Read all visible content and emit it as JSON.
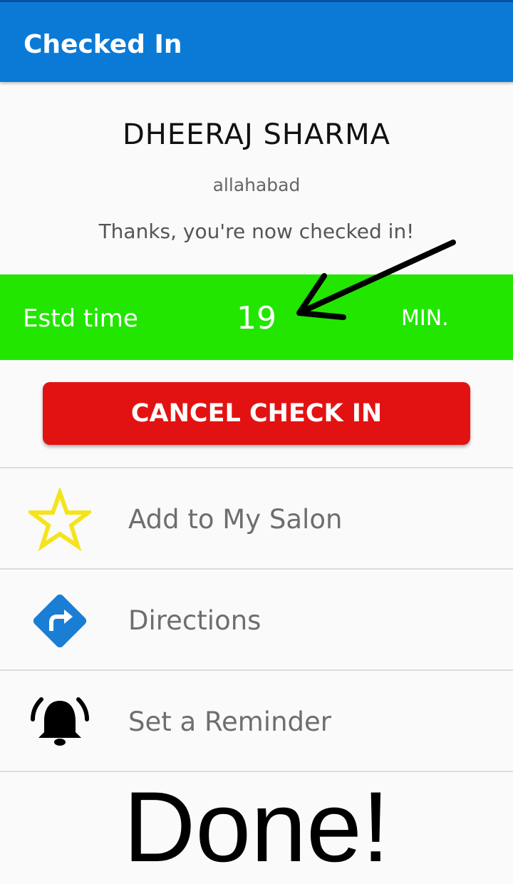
{
  "app_bar": {
    "title": "Checked In",
    "background": "#0a7ad6"
  },
  "salon": {
    "name": "DHEERAJ SHARMA",
    "city": "allahabad",
    "message": "Thanks, you're now checked in!"
  },
  "estimate": {
    "label": "Estd time",
    "value": "19",
    "unit": "MIN.",
    "background": "#22e600"
  },
  "cancel_button": {
    "label": "CANCEL CHECK IN",
    "background": "#e31212"
  },
  "actions": [
    {
      "label": "Add to My Salon",
      "icon": "star-outline-icon",
      "icon_color": "#f5e31d"
    },
    {
      "label": "Directions",
      "icon": "directions-icon",
      "icon_color": "#1a7fd4"
    },
    {
      "label": "Set a Reminder",
      "icon": "bell-ringing-icon",
      "icon_color": "#000000"
    }
  ],
  "annotation": {
    "overlay_text": "Done!",
    "arrow": "arrow-pointing-icon"
  }
}
